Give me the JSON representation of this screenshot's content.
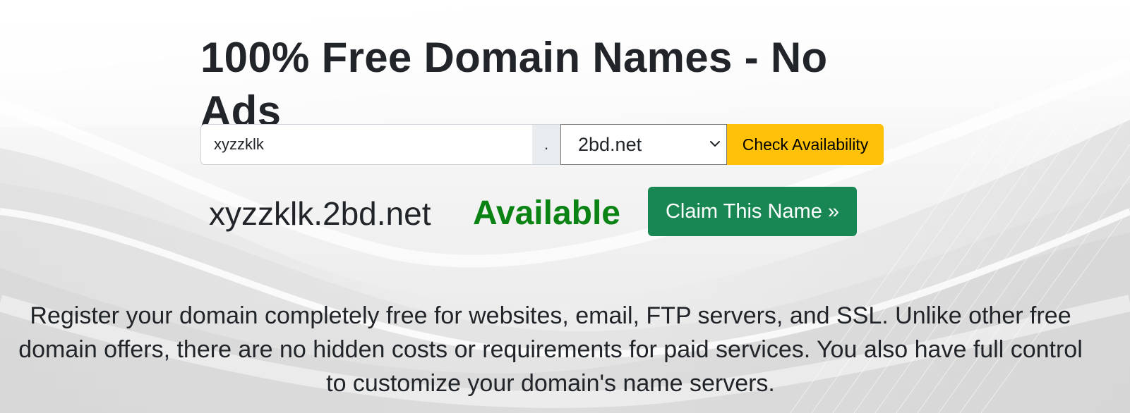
{
  "hero": {
    "title": "100% Free Domain Names - No Ads"
  },
  "search": {
    "name_value": "xyzzklk",
    "separator": ".",
    "tld_selected": "2bd.net",
    "check_label": "Check Availability"
  },
  "result": {
    "domain": "xyzzklk.2bd.net",
    "status": "Available",
    "claim_label": "Claim This Name »"
  },
  "description": "Register your domain completely free for websites, email, FTP servers, and SSL. Unlike other free domain offers, there are no hidden costs or requirements for paid services. You also have full control to customize your domain's name servers.",
  "colors": {
    "check_button": "#ffc107",
    "claim_button": "#198754",
    "available_text": "#0a8214"
  },
  "icons": {
    "select_arrow": "chevron-down-icon"
  }
}
